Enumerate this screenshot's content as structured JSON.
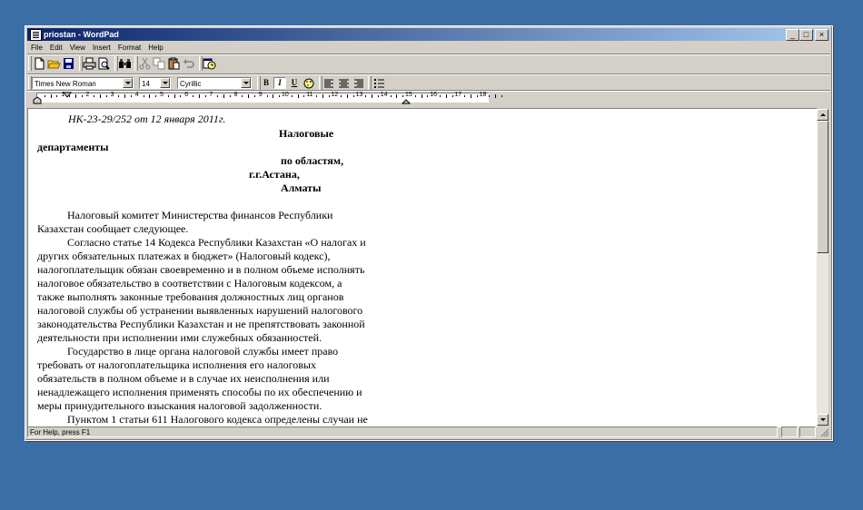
{
  "window": {
    "title": "priostan - WordPad",
    "caption_buttons": {
      "minimize": "_",
      "maximize": "□",
      "close": "×"
    }
  },
  "menu": [
    "File",
    "Edit",
    "View",
    "Insert",
    "Format",
    "Help"
  ],
  "toolbar": {
    "icons": [
      "new-document-icon",
      "open-folder-icon",
      "save-disk-icon",
      "print-icon",
      "print-preview-icon",
      "find-binoculars-icon",
      "cut-icon",
      "copy-icon",
      "paste-icon",
      "undo-icon",
      "insert-datetime-icon"
    ]
  },
  "format_bar": {
    "font_name": "Times New Roman",
    "font_size": "14",
    "script": "Cyrillic",
    "bold": "B",
    "italic": "I",
    "underline": "U"
  },
  "ruler": {
    "numbers": [
      "1",
      "2",
      "3",
      "4",
      "5",
      "6",
      "7",
      "8",
      "9",
      "10",
      "11",
      "12",
      "13",
      "14",
      "15",
      "16",
      "17",
      "18"
    ]
  },
  "document": {
    "ref_line": "НК-23-29/252 от 12 января 2011г.",
    "addr1": "Налоговые",
    "addr2": "департаменты",
    "addr3": "по областям,",
    "addr4": "г.г.Астана,",
    "addr5": "Алматы",
    "paragraphs": [
      "Налоговый комитет Министерства финансов Республики",
      "Казахстан сообщает следующее.",
      "Согласно статье 14 Кодекса Республики Казахстан «О налогах и",
      "других обязательных платежах в бюджет» (Налоговый кодекс),",
      "налогоплательщик обязан своевременно и в полном объеме исполнять",
      "налоговое обязательство в соответствии с Налоговым кодексом, а",
      "также выполнять законные требования должностных лиц органов",
      "налоговой службы об устранении выявленных нарушений налогового",
      "законодательства Республики Казахстан и не препятствовать законной",
      "деятельности при исполнении ими служебных обязанностей.",
      "Государство в лице органа налоговой службы имеет право",
      "требовать от налогоплательщика исполнения его налоговых",
      "обязательств в полном объеме и в случае их неисполнения или",
      "ненадлежащего исполнения применять способы по их обеспечению и",
      "меры принудительного взыскания налоговой задолженности.",
      "Пунктом 1 статьи 611 Налогового кодекса определены случаи не"
    ]
  },
  "status_bar": {
    "text": "For Help, press F1"
  },
  "colors": {
    "desktop": "#3a6ea5",
    "titlebar_start": "#0a246a",
    "titlebar_end": "#a6caf0",
    "chrome": "#d4d0c8"
  }
}
